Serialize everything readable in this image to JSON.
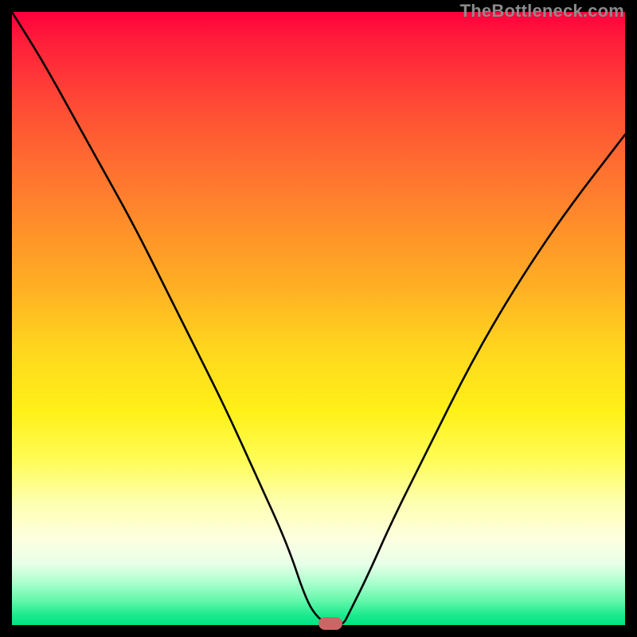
{
  "watermark": "TheBottleneck.com",
  "colors": {
    "frame": "#000000",
    "curve": "#000000",
    "marker": "#cc6666",
    "gradient_top": "#ff003d",
    "gradient_bottom": "#00e482"
  },
  "chart_data": {
    "type": "line",
    "title": "",
    "xlabel": "",
    "ylabel": "",
    "xlim": [
      0,
      100
    ],
    "ylim": [
      0,
      100
    ],
    "annotations": [
      "TheBottleneck.com"
    ],
    "series": [
      {
        "name": "bottleneck-curve",
        "x": [
          0,
          5,
          10,
          15,
          20,
          25,
          30,
          35,
          40,
          45,
          48,
          50,
          52,
          54,
          55,
          58,
          62,
          68,
          75,
          82,
          90,
          100
        ],
        "y": [
          100,
          92,
          83,
          74,
          65,
          55,
          45,
          35,
          24,
          13,
          4,
          1,
          0,
          0,
          2,
          8,
          17,
          29,
          43,
          55,
          67,
          80
        ]
      }
    ],
    "marker": {
      "x": 52,
      "y": 0,
      "width_pct": 3.9,
      "height_pct": 2.1
    }
  }
}
